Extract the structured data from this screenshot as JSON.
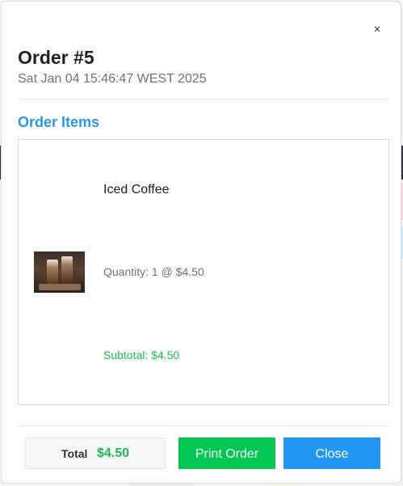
{
  "modal": {
    "close_symbol": "×",
    "title": "Order #5",
    "timestamp": "Sat Jan 04 15:46:47 WEST 2025",
    "section_title": "Order Items"
  },
  "items": [
    {
      "name": "Iced Coffee",
      "quantity_text": "Quantity: 1 @ $4.50",
      "subtotal_text": "Subtotal: $4.50",
      "image": "iced-coffee-photo"
    }
  ],
  "footer": {
    "total_label": "Total",
    "total_value": "$4.50",
    "print_label": "Print Order",
    "close_label": "Close"
  },
  "colors": {
    "accent_blue": "#2196f3",
    "section_title_blue": "#2a97e6",
    "print_green": "#00c853",
    "money_green": "#1db954"
  }
}
